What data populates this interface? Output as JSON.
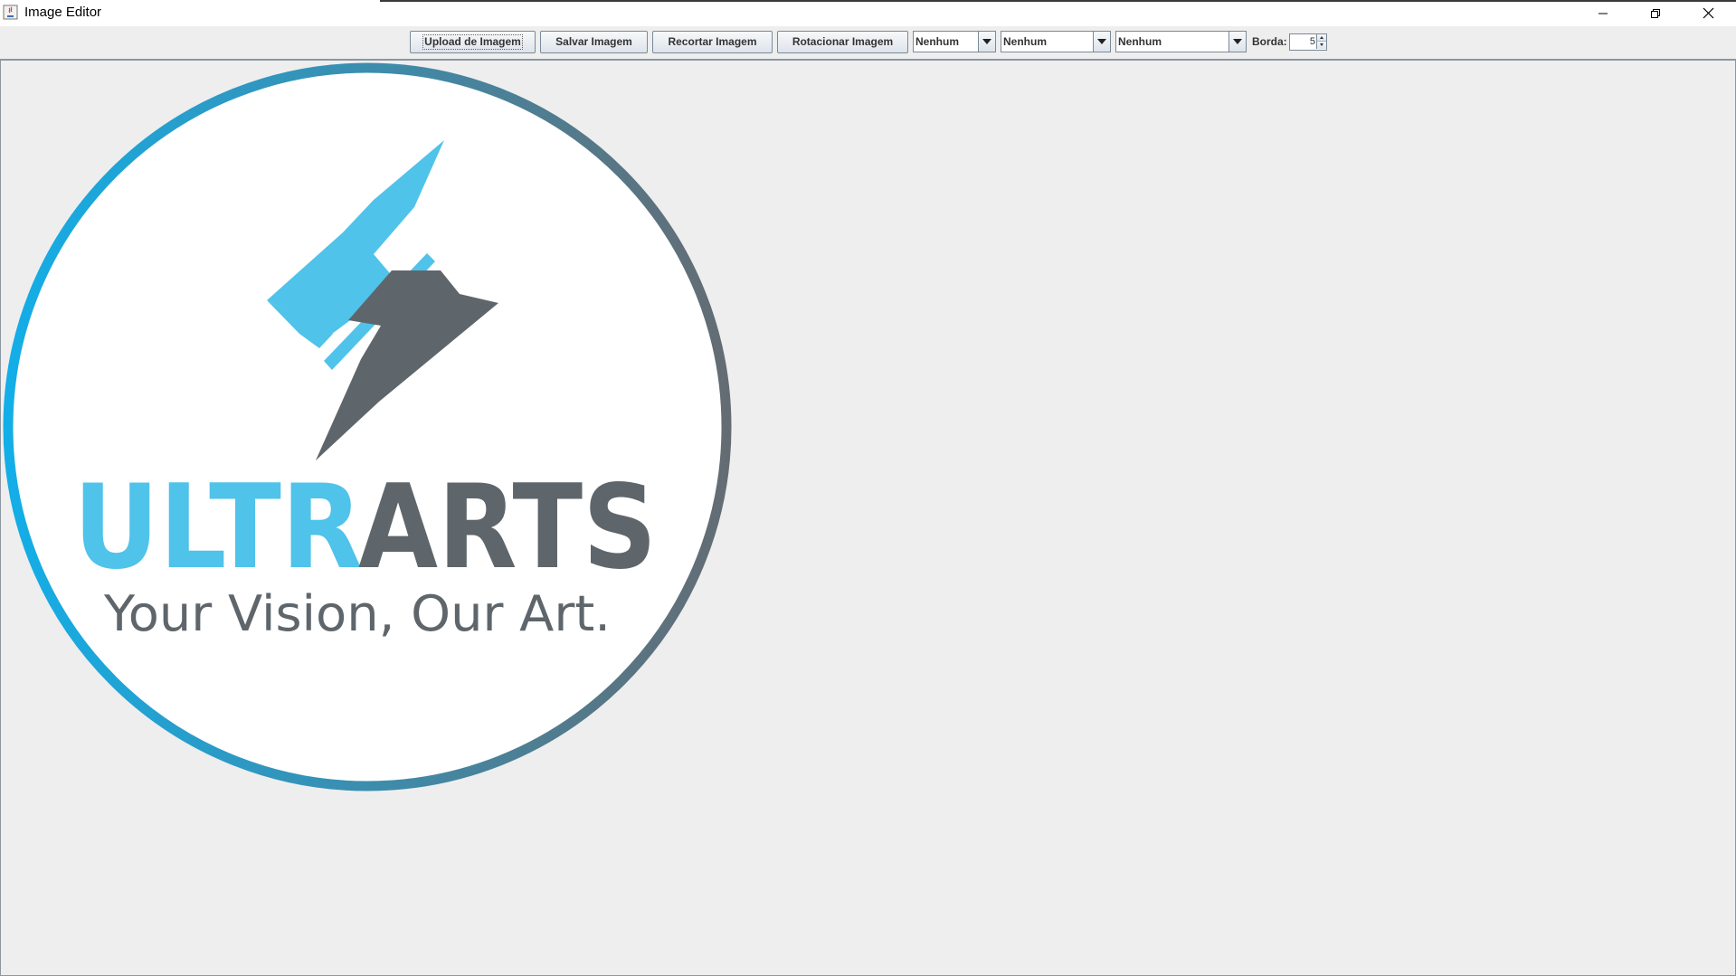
{
  "window": {
    "title": "Image Editor",
    "controls": {
      "minimize_icon": "minimize-icon",
      "maximize_icon": "restore-icon",
      "close_icon": "close-icon"
    }
  },
  "toolbar": {
    "upload_label": "Upload de Imagem",
    "save_label": "Salvar Imagem",
    "crop_label": "Recortar Imagem",
    "rotate_label": "Rotacionar Imagem",
    "filter_1_value": "Nenhum",
    "filter_2_value": "Nenhum",
    "filter_3_value": "Nenhum",
    "border_label": "Borda:",
    "border_value": "5"
  },
  "canvas": {
    "image": {
      "brand_left": "ULTR",
      "brand_right": "ARTS",
      "tagline": "Your Vision, Our Art.",
      "colors": {
        "accent_blue": "#4fc3ea",
        "dark_gray": "#5f666b",
        "ring_start": "#13aee8",
        "ring_end": "#646c73"
      }
    },
    "background": "#eeeeef"
  }
}
